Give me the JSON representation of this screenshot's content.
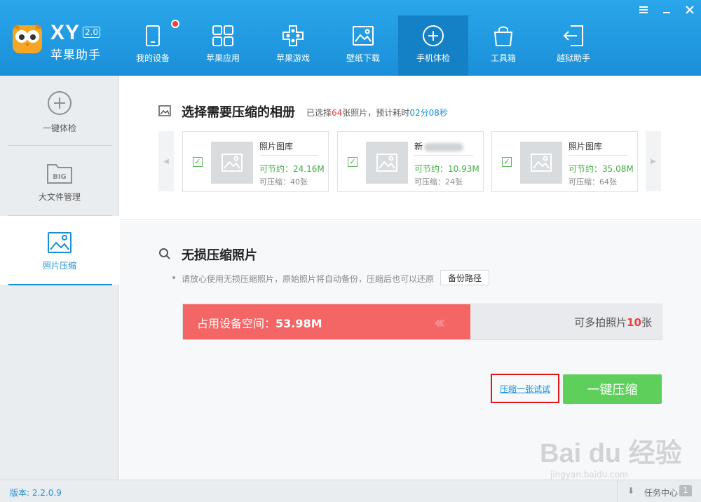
{
  "app": {
    "brand": "XY",
    "version_badge": "2.0",
    "subtitle": "苹果助手"
  },
  "nav": [
    {
      "label": "我的设备",
      "icon": "tablet-icon",
      "has_dot": true
    },
    {
      "label": "苹果应用",
      "icon": "apps-grid-icon"
    },
    {
      "label": "苹果游戏",
      "icon": "gamepad-icon"
    },
    {
      "label": "壁纸下载",
      "icon": "image-icon"
    },
    {
      "label": "手机体检",
      "icon": "plus-circle-icon",
      "active": true
    },
    {
      "label": "工具箱",
      "icon": "toolbox-icon"
    },
    {
      "label": "越狱助手",
      "icon": "exit-icon"
    }
  ],
  "window_controls": [
    "menu-icon",
    "minimize-icon",
    "close-icon"
  ],
  "sidebar": [
    {
      "label": "一键体检",
      "icon": "plus-circle-icon"
    },
    {
      "label": "大文件管理",
      "icon": "big-folder-icon",
      "badge": "BIG"
    },
    {
      "label": "照片压缩",
      "icon": "photo-icon",
      "active": true
    }
  ],
  "section1": {
    "title": "选择需要压缩的相册",
    "sub_pre": "已选择",
    "sub_count": "64",
    "sub_mid": "张照片，预计耗时",
    "sub_time": "02分08秒",
    "albums": [
      {
        "name": "照片图库",
        "save": "可节约：24.16M",
        "count": "可压缩：40张",
        "checked": true
      },
      {
        "name": "新",
        "save": "可节约：10.93M",
        "count": "可压缩：24张",
        "checked": true,
        "name_blurred": true
      },
      {
        "name": "照片图库",
        "save": "可节约：35.08M",
        "count": "可压缩：64张",
        "checked": true
      }
    ]
  },
  "section2": {
    "title": "无损压缩照片",
    "hint": "请放心使用无损压缩照片，原始照片将自动备份，压缩后也可以还原",
    "backup_button": "备份路径",
    "bar": {
      "used_label": "占用设备空间：",
      "used_value": "53.98M",
      "fill_fraction": 0.6,
      "more_pre": "可多拍照片",
      "more_count": "10",
      "more_post": "张"
    },
    "try_link": "压缩一张试试",
    "compress_button": "一键压缩"
  },
  "footer": {
    "version": "版本: 2.2.0.9",
    "task_label": "任务中心",
    "task_count": "1"
  },
  "watermark": {
    "logo": "Bai du 经验",
    "url": "jingyan.baidu.com"
  },
  "colors": {
    "header": "#1a8fd9",
    "accent": "#1a8fd9",
    "bar_fill": "#f46565",
    "green": "#5ecf5a",
    "red": "#f23b3b"
  }
}
